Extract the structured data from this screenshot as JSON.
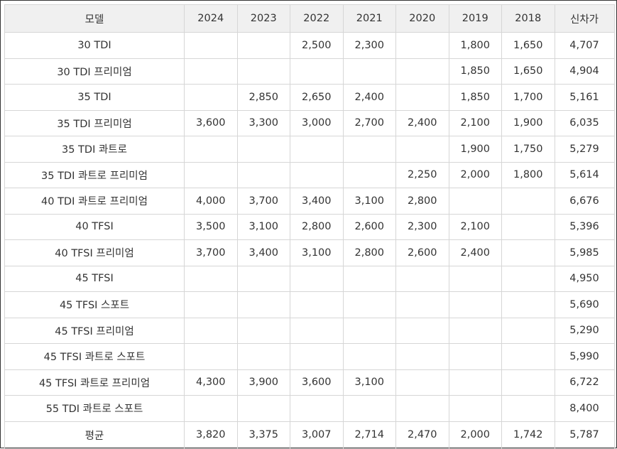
{
  "table": {
    "headers": [
      "모델",
      "2024",
      "2023",
      "2022",
      "2021",
      "2020",
      "2019",
      "2018",
      "신차가"
    ],
    "rows": [
      [
        "30 TDI",
        "",
        "",
        "2,500",
        "2,300",
        "",
        "1,800",
        "1,650",
        "4,707"
      ],
      [
        "30 TDI 프리미엄",
        "",
        "",
        "",
        "",
        "",
        "1,850",
        "1,650",
        "4,904"
      ],
      [
        "35 TDI",
        "",
        "2,850",
        "2,650",
        "2,400",
        "",
        "1,850",
        "1,700",
        "5,161"
      ],
      [
        "35 TDI 프리미엄",
        "3,600",
        "3,300",
        "3,000",
        "2,700",
        "2,400",
        "2,100",
        "1,900",
        "6,035"
      ],
      [
        "35 TDI 콰트로",
        "",
        "",
        "",
        "",
        "",
        "1,900",
        "1,750",
        "5,279"
      ],
      [
        "35 TDI 콰트로 프리미엄",
        "",
        "",
        "",
        "",
        "2,250",
        "2,000",
        "1,800",
        "5,614"
      ],
      [
        "40 TDI 콰트로 프리미엄",
        "4,000",
        "3,700",
        "3,400",
        "3,100",
        "2,800",
        "",
        "",
        "6,676"
      ],
      [
        "40 TFSI",
        "3,500",
        "3,100",
        "2,800",
        "2,600",
        "2,300",
        "2,100",
        "",
        "5,396"
      ],
      [
        "40 TFSI 프리미엄",
        "3,700",
        "3,400",
        "3,100",
        "2,800",
        "2,600",
        "2,400",
        "",
        "5,985"
      ],
      [
        "45 TFSI",
        "",
        "",
        "",
        "",
        "",
        "",
        "",
        "4,950"
      ],
      [
        "45 TFSI 스포트",
        "",
        "",
        "",
        "",
        "",
        "",
        "",
        "5,690"
      ],
      [
        "45 TFSI 프리미엄",
        "",
        "",
        "",
        "",
        "",
        "",
        "",
        "5,290"
      ],
      [
        "45 TFSI 콰트로 스포트",
        "",
        "",
        "",
        "",
        "",
        "",
        "",
        "5,990"
      ],
      [
        "45 TFSI 콰트로 프리미엄",
        "4,300",
        "3,900",
        "3,600",
        "3,100",
        "",
        "",
        "",
        "6,722"
      ],
      [
        "55 TDI 콰트로 스포트",
        "",
        "",
        "",
        "",
        "",
        "",
        "",
        "8,400"
      ],
      [
        "평균",
        "3,820",
        "3,375",
        "3,007",
        "2,714",
        "2,470",
        "2,000",
        "1,742",
        "5,787"
      ]
    ]
  },
  "colors": {
    "header_bg": "#f0f0f0",
    "grid_line": "#d6d6d6",
    "text": "#333333",
    "frame_border": "#333333"
  }
}
